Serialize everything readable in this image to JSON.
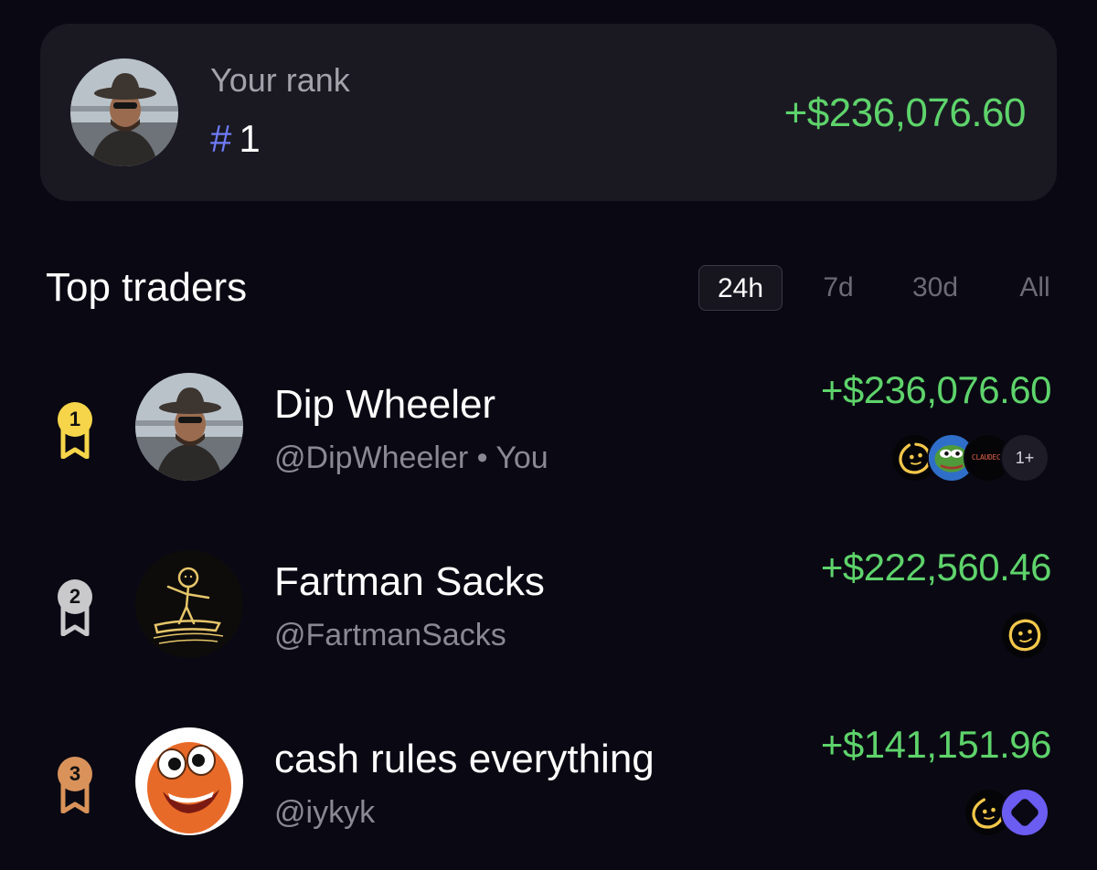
{
  "rank_card": {
    "caption": "Your rank",
    "hash": "#",
    "rank": "1",
    "pnl": "+$236,076.60"
  },
  "leaderboard": {
    "title": "Top traders",
    "tabs": [
      {
        "label": "24h",
        "active": true
      },
      {
        "label": "7d",
        "active": false
      },
      {
        "label": "30d",
        "active": false
      },
      {
        "label": "All",
        "active": false
      }
    ],
    "traders": [
      {
        "rank": "1",
        "medal": "gold-medal-icon",
        "name": "Dip Wheeler",
        "handle": "@DipWheeler • You",
        "pnl": "+$236,076.60",
        "tokens": [
          "smiley-token-icon",
          "pepe-token-icon",
          "claudech-token-icon"
        ],
        "claudech_label": "CLAUDECH",
        "more_label": "1+"
      },
      {
        "rank": "2",
        "medal": "silver-medal-icon",
        "name": "Fartman Sacks",
        "handle": "@FartmanSacks",
        "pnl": "+$222,560.46",
        "tokens": [
          "smiley-token-icon"
        ]
      },
      {
        "rank": "3",
        "medal": "bronze-medal-icon",
        "name": "cash rules everything",
        "handle": "@iykyk",
        "pnl": "+$141,151.96",
        "tokens": [
          "smiley-token-icon",
          "purple-square-token-icon"
        ]
      }
    ]
  },
  "colors": {
    "background": "#0a0913",
    "card": "#1a1922",
    "positive": "#5ed36b",
    "rank_hash": "#6f7bf7",
    "gold": "#f6d54a",
    "silver": "#c9c9cc",
    "bronze": "#d9925a"
  }
}
